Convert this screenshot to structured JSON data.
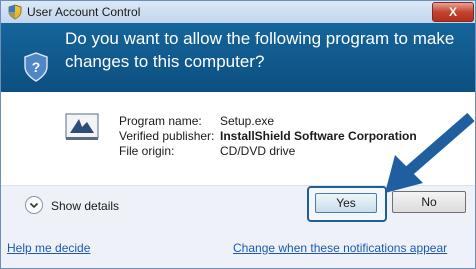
{
  "window": {
    "title": "User Account Control",
    "close_label": "X"
  },
  "header": {
    "question": "Do you want to allow the following program to make changes to this computer?"
  },
  "program": {
    "name_label": "Program name:",
    "name_value": "Setup.exe",
    "publisher_label": "Verified publisher:",
    "publisher_value": "InstallShield Software Corporation",
    "origin_label": "File origin:",
    "origin_value": "CD/DVD drive"
  },
  "footer": {
    "details_label": "Show details",
    "yes_label": "Yes",
    "no_label": "No",
    "help_link": "Help me decide",
    "notify_link": "Change when these notifications appear"
  },
  "colors": {
    "header_bg": "#0d4f80",
    "link": "#1d58b0",
    "arrow": "#1f5fa0"
  },
  "icons": [
    "shield-icon",
    "uac-shield-question-icon",
    "program-icon",
    "chevron-down-icon",
    "pointer-arrow-icon"
  ]
}
